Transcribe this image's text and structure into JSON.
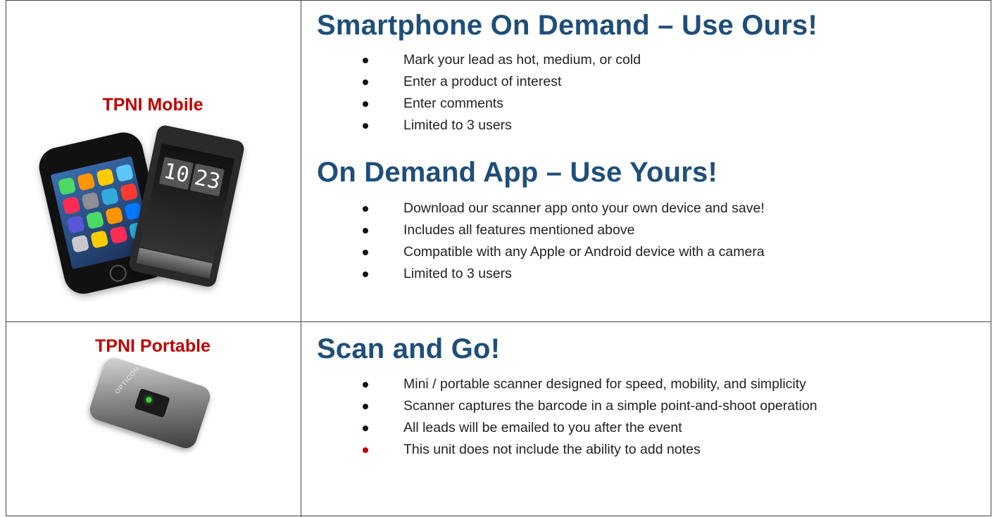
{
  "rows": [
    {
      "label": "TPNI Mobile",
      "sections": [
        {
          "heading": "Smartphone On Demand – Use Ours!",
          "bullets": [
            "Mark your lead as hot, medium, or cold",
            "Enter a product of interest",
            "Enter comments",
            "Limited to 3 users"
          ]
        },
        {
          "heading": "On Demand App – Use Yours!",
          "bullets": [
            "Download our scanner app onto your own device and save!",
            "Includes all features mentioned above",
            "Compatible with any Apple or Android device with a camera",
            "Limited to 3 users"
          ]
        }
      ],
      "image": "smartphones-image"
    },
    {
      "label": "TPNI Portable",
      "sections": [
        {
          "heading": "Scan and Go!",
          "bullets": [
            "Mini / portable scanner designed for speed, mobility, and simplicity",
            "Scanner captures the barcode in a simple point-and-shoot operation",
            "All leads will be emailed to you after the event",
            "This unit does not include the ability to add notes"
          ]
        }
      ],
      "image": "portable-scanner-image"
    }
  ],
  "phone_clock": [
    "10",
    "23"
  ],
  "scanner_brand": "OPTICON",
  "colors": {
    "label": "#c00000",
    "heading": "#1f4e79",
    "text": "#222222",
    "last_bullet": "#c00000"
  }
}
